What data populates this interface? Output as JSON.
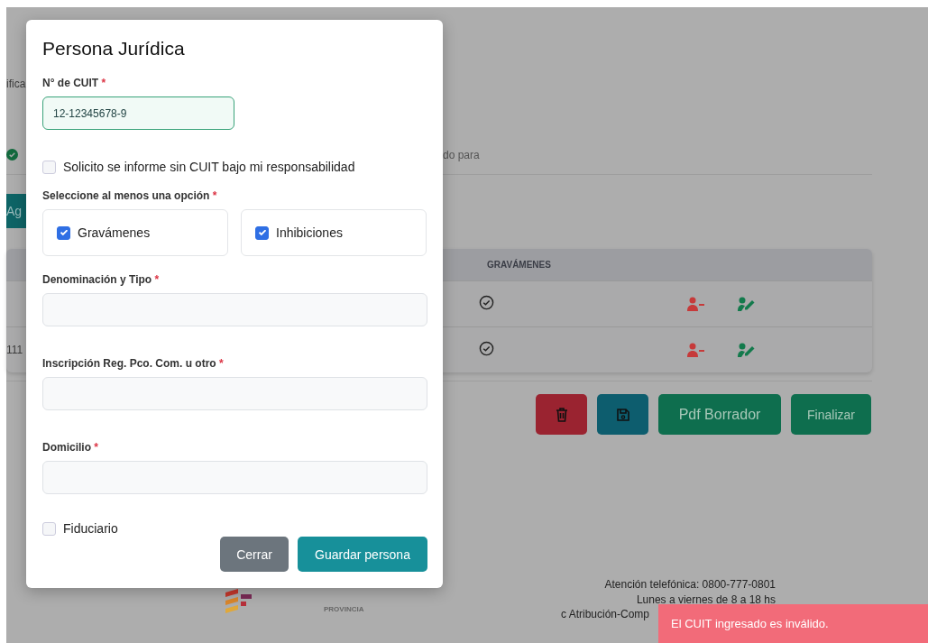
{
  "background": {
    "left_fragments": [
      "ifica",
      "111"
    ],
    "step": {
      "done": true,
      "label": "do para"
    },
    "add_button": {
      "label": "Ag"
    },
    "table": {
      "columns": [
        "GRAVÁMENES"
      ],
      "rows": [
        {
          "gravamenes": true
        },
        {
          "gravamenes": true
        }
      ]
    },
    "actions": [
      {
        "kind": "delete"
      },
      {
        "kind": "save"
      },
      {
        "kind": "pdf",
        "label": "Pdf Borrador"
      },
      {
        "kind": "finish",
        "label": "Finalizar"
      }
    ],
    "footer": {
      "logo_subtitle": "PROVINCIA",
      "lines": [
        "Atención telefónica: 0800-777-0801",
        "Lunes a viernes de 8 a 18 hs",
        "c Atribución-Comp"
      ]
    }
  },
  "modal": {
    "title": "Persona Jurídica",
    "cuit": {
      "label": "N° de CUIT",
      "required_mark": "*",
      "value": "12-12345678-9",
      "valid": true
    },
    "no_cuit": {
      "label": "Solicito se informe sin CUIT bajo mi responsabilidad",
      "checked": false
    },
    "options_label": {
      "label": "Seleccione al menos una opción",
      "required_mark": "*"
    },
    "options": [
      {
        "label": "Gravámenes",
        "checked": true
      },
      {
        "label": "Inhibiciones",
        "checked": true
      }
    ],
    "fields": [
      {
        "label": "Denominación y Tipo",
        "required_mark": "*"
      },
      {
        "label": "Inscripción Reg. Pco. Com. u otro",
        "required_mark": "*"
      },
      {
        "label": "Domicilio",
        "required_mark": "*"
      }
    ],
    "fiduciario": {
      "label": "Fiduciario",
      "checked": false
    },
    "buttons": [
      {
        "kind": "secondary",
        "label": "Cerrar"
      },
      {
        "kind": "primary",
        "label": "Guardar persona"
      }
    ]
  },
  "toast": {
    "message": "El CUIT ingresado es inválido."
  }
}
